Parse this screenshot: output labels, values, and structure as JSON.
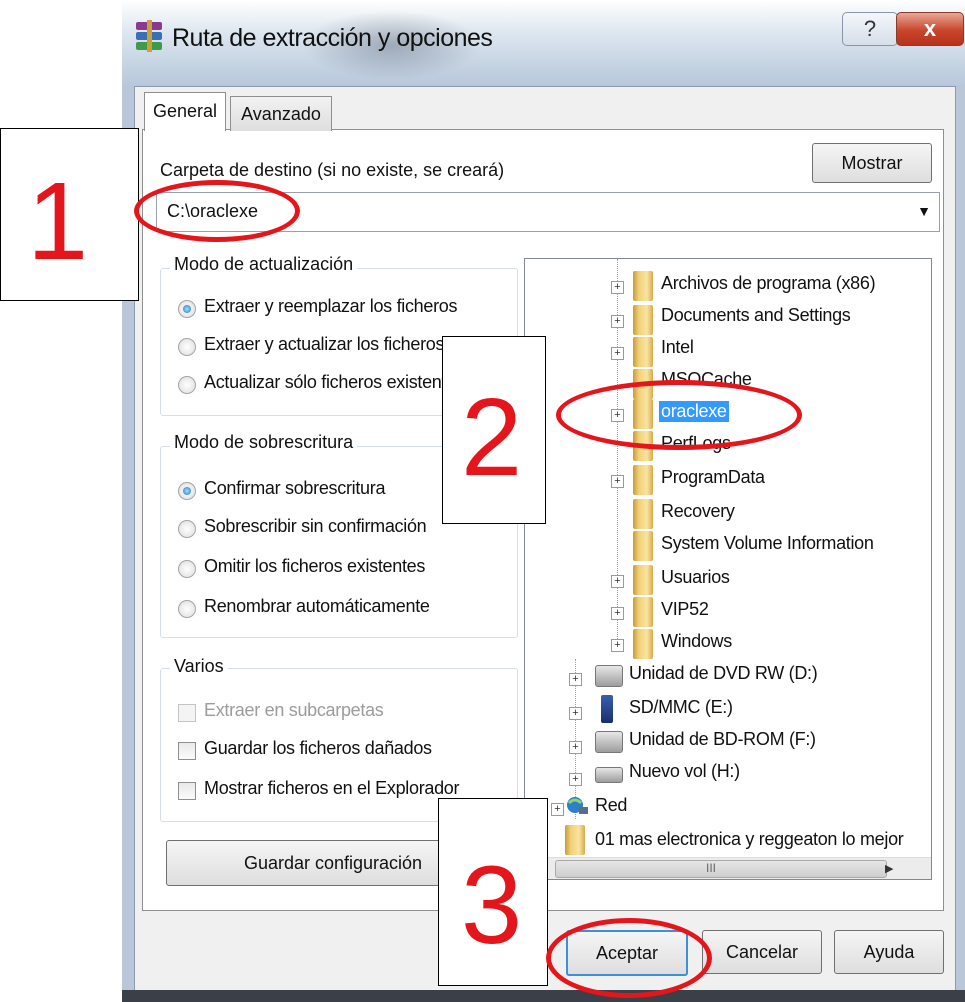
{
  "window": {
    "title": "Ruta de extracción y opciones",
    "help_glyph": "?",
    "close_glyph": "x"
  },
  "tabs": [
    {
      "label": "General",
      "active": true
    },
    {
      "label": "Avanzado",
      "active": false
    }
  ],
  "destination": {
    "label": "Carpeta de destino (si no existe, se creará)",
    "value": "C:\\oraclexe",
    "dropdown_glyph": "▼",
    "show_button": "Mostrar"
  },
  "update_mode": {
    "title": "Modo de actualización",
    "options": [
      {
        "label": "Extraer y reemplazar los ficheros",
        "selected": true
      },
      {
        "label": "Extraer y actualizar los ficheros",
        "selected": false
      },
      {
        "label": "Actualizar sólo ficheros existentes",
        "selected": false
      }
    ]
  },
  "overwrite_mode": {
    "title": "Modo de sobrescritura",
    "options": [
      {
        "label": "Confirmar sobrescritura",
        "selected": true
      },
      {
        "label": "Sobrescribir sin confirmación",
        "selected": false
      },
      {
        "label": "Omitir los ficheros existentes",
        "selected": false
      },
      {
        "label": "Renombrar automáticamente",
        "selected": false
      }
    ]
  },
  "misc": {
    "title": "Varios",
    "options": [
      {
        "label": "Extraer en subcarpetas",
        "checked": false,
        "disabled": true
      },
      {
        "label": "Guardar los ficheros dañados",
        "checked": false,
        "disabled": false
      },
      {
        "label": "Mostrar ficheros en el Explorador",
        "checked": false,
        "disabled": false
      }
    ]
  },
  "save_button": "Guardar configuración",
  "tree": {
    "items": [
      {
        "label": "Archivos de programa (x86)",
        "icon": "folder-icon",
        "expandable": true
      },
      {
        "label": "Documents and Settings",
        "icon": "folder-icon",
        "expandable": true
      },
      {
        "label": "Intel",
        "icon": "folder-icon",
        "expandable": true
      },
      {
        "label": "MSOCache",
        "icon": "folder-icon",
        "expandable": false
      },
      {
        "label": "oraclexe",
        "icon": "folder-icon",
        "expandable": true,
        "selected": true
      },
      {
        "label": "PerfLogs",
        "icon": "folder-icon",
        "expandable": false
      },
      {
        "label": "ProgramData",
        "icon": "folder-icon",
        "expandable": true
      },
      {
        "label": "Recovery",
        "icon": "folder-icon",
        "expandable": false
      },
      {
        "label": "System Volume Information",
        "icon": "folder-icon",
        "expandable": false
      },
      {
        "label": "Usuarios",
        "icon": "folder-icon",
        "expandable": true
      },
      {
        "label": "VIP52",
        "icon": "folder-icon",
        "expandable": true
      },
      {
        "label": "Windows",
        "icon": "folder-icon",
        "expandable": true
      },
      {
        "label": "Unidad de DVD RW (D:)",
        "icon": "dvd-drive-icon",
        "expandable": true
      },
      {
        "label": "SD/MMC (E:)",
        "icon": "sd-card-icon",
        "expandable": true
      },
      {
        "label": "Unidad de BD-ROM (F:)",
        "icon": "bd-drive-icon",
        "expandable": true
      },
      {
        "label": "Nuevo vol (H:)",
        "icon": "hard-drive-icon",
        "expandable": true
      },
      {
        "label": "Red",
        "icon": "network-icon",
        "expandable": true
      },
      {
        "label": "01 mas electronica y reggeaton lo mejor",
        "icon": "folder-icon",
        "expandable": false
      }
    ],
    "hscroll_grip": "III",
    "vscroll_grip": "≡"
  },
  "buttons": {
    "accept": "Aceptar",
    "cancel": "Cancelar",
    "help": "Ayuda"
  },
  "annotations": {
    "step1": "1",
    "step2": "2",
    "step3": "3",
    "color": "#e4161b"
  }
}
